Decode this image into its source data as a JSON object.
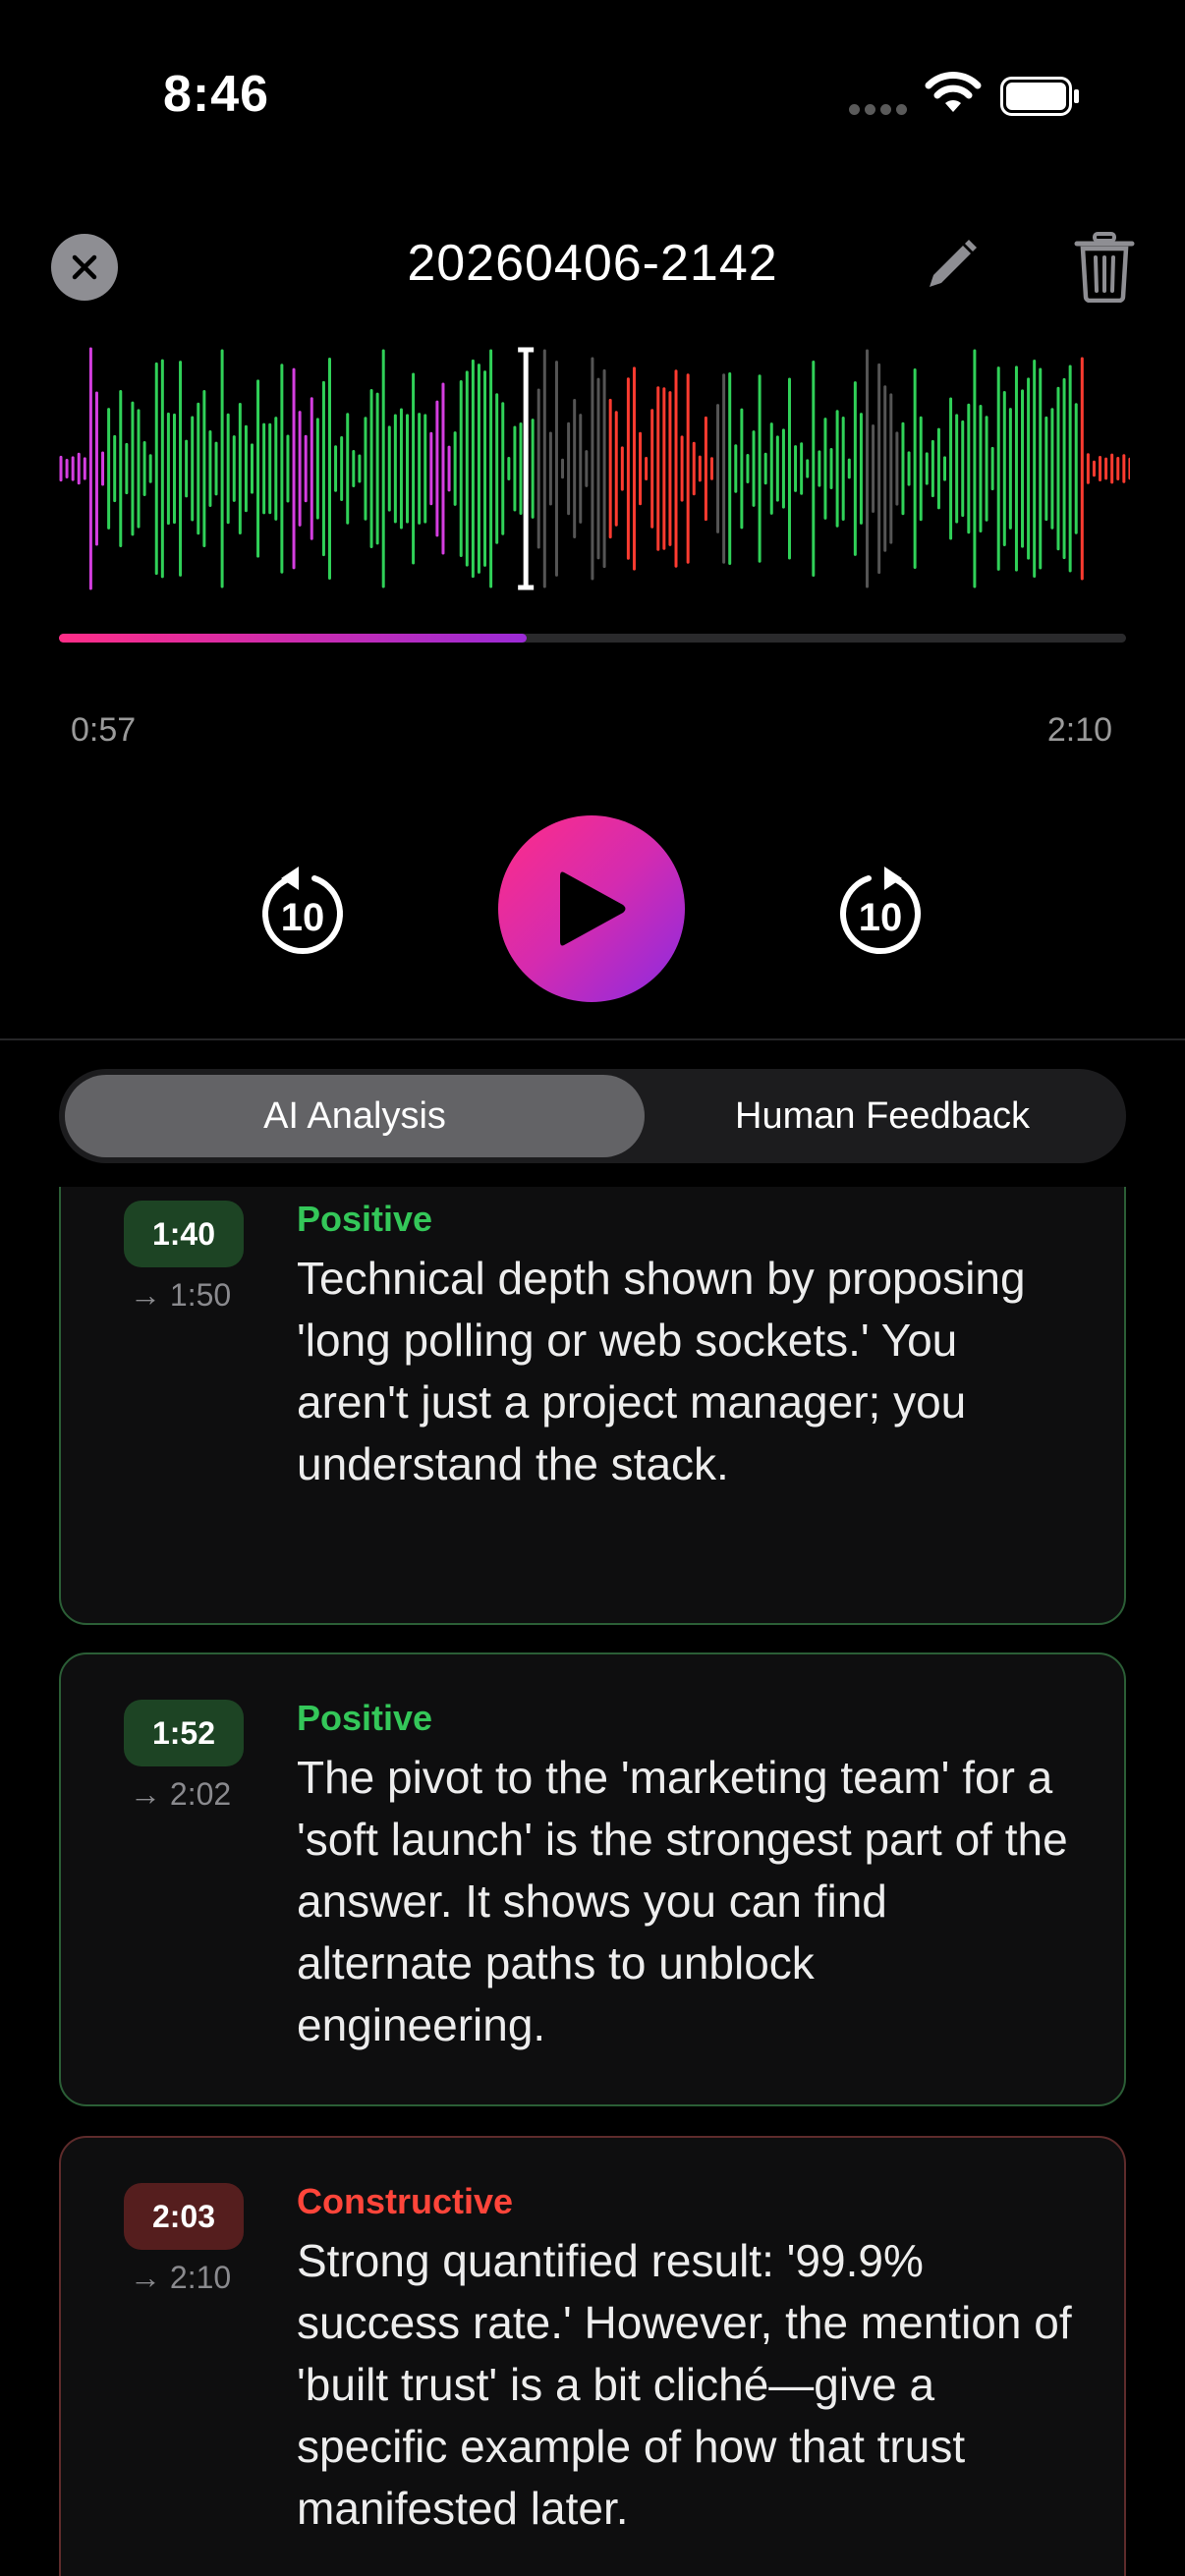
{
  "status_bar": {
    "time": "8:46"
  },
  "header": {
    "title": "20260406-2142"
  },
  "player": {
    "elapsed": "0:57",
    "total": "2:10",
    "progress_fraction": 0.438,
    "skip_back_label": "10",
    "skip_forward_label": "10"
  },
  "tabs": {
    "ai_analysis": "AI Analysis",
    "human_feedback": "Human Feedback",
    "selected": "AI Analysis"
  },
  "colors": {
    "positive": "#34c759",
    "constructive": "#ff453a",
    "accent_pink": "#ff2d87",
    "accent_purple": "#8a2be2",
    "waveform_neutral": "#555555"
  },
  "feedback": [
    {
      "start": "1:40",
      "end": "→ 1:50",
      "kind": "Positive",
      "text": "Technical depth shown by proposing 'long polling or web sockets.' You aren't just a project manager; you understand the stack."
    },
    {
      "start": "1:52",
      "end": "→ 2:02",
      "kind": "Positive",
      "text": "The pivot to the 'marketing team' for a 'soft launch' is the strongest part of the answer. It shows you can find alternate paths to unblock engineering."
    },
    {
      "start": "2:03",
      "end": "→ 2:10",
      "kind": "Constructive",
      "text": "Strong quantified result: '99.9% success rate.' However, the mention of 'built trust' is a bit cliché—give a specific example of how that trust manifested later."
    }
  ]
}
